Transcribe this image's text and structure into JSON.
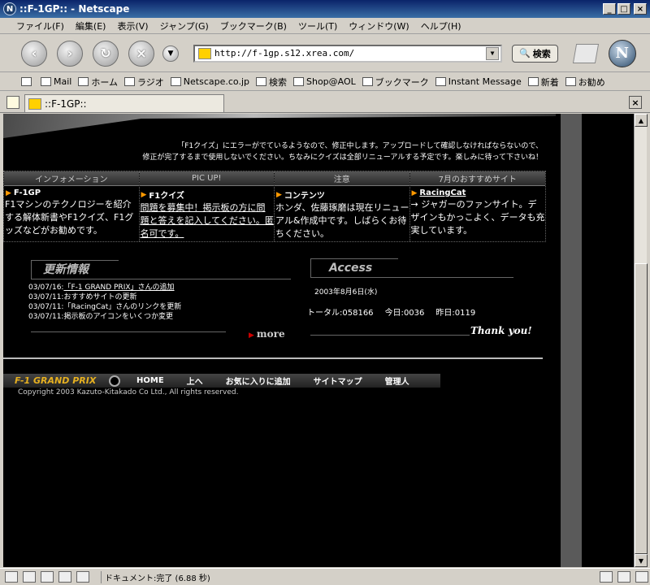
{
  "window": {
    "title": "::F-1GP:: - Netscape",
    "controls": [
      "_",
      "□",
      "×"
    ]
  },
  "menu": [
    "ファイル(F)",
    "編集(E)",
    "表示(V)",
    "ジャンプ(G)",
    "ブックマーク(B)",
    "ツール(T)",
    "ウィンドウ(W)",
    "ヘルプ(H)"
  ],
  "nav": {
    "url": "http://f-1gp.s12.xrea.com/",
    "search_label": "検索",
    "back_icon": "back-arrow-icon",
    "forward_icon": "forward-arrow-icon",
    "reload_icon": "reload-icon",
    "stop_icon": "stop-icon"
  },
  "personal_toolbar": [
    "Mail",
    "ホーム",
    "ラジオ",
    "Netscape.co.jp",
    "検索",
    "Shop@AOL",
    "ブックマーク",
    "Instant Message",
    "新着",
    "お勧め"
  ],
  "tab": {
    "title": "::F-1GP::"
  },
  "page": {
    "notice_line1": "「F1クイズ」にエラーがでているようなので、修正中します。アップロードして確認しなければならないので、",
    "notice_line2": "修正が完了するまで使用しないでください。ちなみにクイズは全部リニューアルする予定です。楽しみに待って下さいね！",
    "columns": [
      {
        "head": "インフォメーション",
        "sub": "F-1GP",
        "body": "F1マシンのテクノロジーを紹介する解体新書やF1クイズ、F1グッズなどがお勧めです。",
        "underline": false
      },
      {
        "head": "PIC UP!",
        "sub": "F1クイズ",
        "body": "問題を募集中！掲示板の方に問題と答えを記入してください。匿名可です。",
        "underline": true
      },
      {
        "head": "注意",
        "sub": "コンテンツ",
        "body": "ホンダ、佐藤琢磨は現在リニューアル&作成中です。しばらくお待ちください。",
        "underline": false
      },
      {
        "head": "7月のおすすめサイト",
        "sub": "RacingCat",
        "body": "→ ジャガーのファンサイト。デザインもかっこよく、データも充実しています。",
        "underline": false
      }
    ],
    "news": {
      "title": "更新情報",
      "items": [
        {
          "date": "03/07/16:",
          "text": "「F-1 GRAND PRIX」さんの追加"
        },
        {
          "date": "03/07/11:",
          "text": "おすすめサイトの更新"
        },
        {
          "date": "03/07/11:",
          "text": "「RacingCat」さんのリンクを更新"
        },
        {
          "date": "03/07/11:",
          "text": "掲示板のアイコンをいくつか変更"
        }
      ],
      "more": "more"
    },
    "access": {
      "title": "Access",
      "date": "2003年8月6日(水)",
      "total_label": "トータル:",
      "total": "058166",
      "today_label": "今日:",
      "today": "0036",
      "yesterday_label": "昨日:",
      "yesterday": "0119",
      "thanks": "Thank you!"
    },
    "footer": {
      "logo": "F-1 GRAND PRIX",
      "links": [
        "HOME",
        "上へ",
        "お気に入りに追加",
        "サイトマップ",
        "管理人"
      ],
      "copyright": "Copyright 2003 Kazuto-Kitakado Co Ltd., All rights reserved."
    }
  },
  "status": {
    "text": "ドキュメント:完了 (6.88 秒)"
  }
}
